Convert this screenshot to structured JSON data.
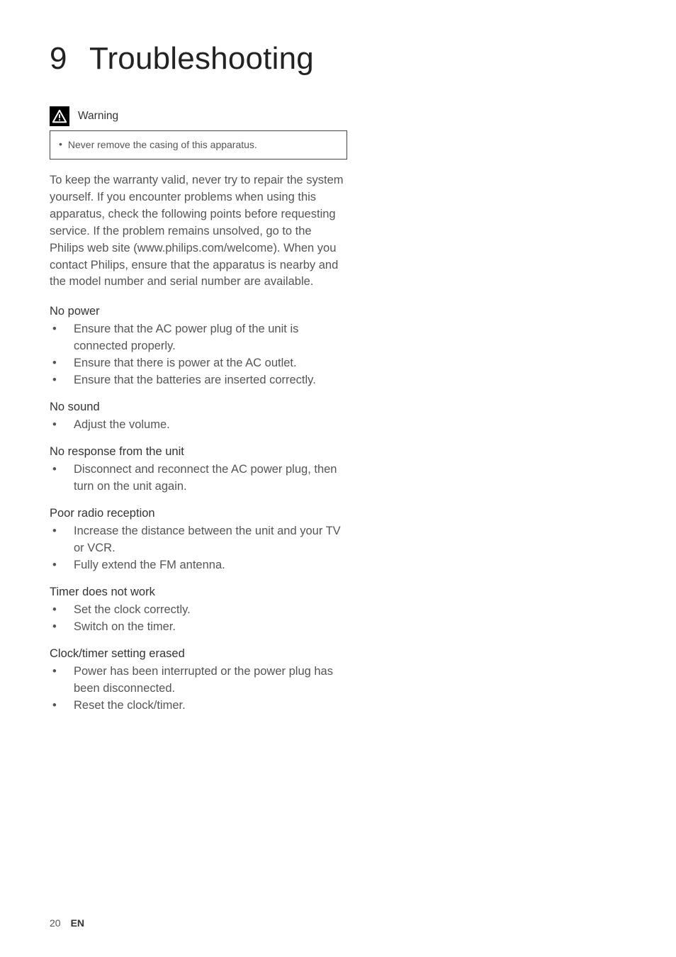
{
  "chapter": {
    "number": "9",
    "title": "Troubleshooting"
  },
  "warning": {
    "label": "Warning",
    "items": [
      "Never remove the casing of this apparatus."
    ]
  },
  "intro": "To keep the warranty valid, never try to repair the system yourself.\nIf you encounter problems when using this apparatus, check the following points before requesting service. If the problem remains unsolved, go to the Philips web site (www.philips.com/welcome). When you contact Philips, ensure that the apparatus is nearby and the model number and serial number are available.",
  "sections": [
    {
      "heading": "No power",
      "items": [
        "Ensure that the AC power plug of the unit is connected properly.",
        "Ensure that there is power at the AC outlet.",
        "Ensure that the batteries are inserted correctly."
      ]
    },
    {
      "heading": "No sound",
      "items": [
        "Adjust the volume."
      ]
    },
    {
      "heading": "No response from the unit",
      "items": [
        "Disconnect and reconnect the AC power plug, then turn on the unit again."
      ]
    },
    {
      "heading": "Poor radio reception",
      "items": [
        "Increase the distance between the unit and your TV or VCR.",
        "Fully extend the FM antenna."
      ]
    },
    {
      "heading": "Timer does not work",
      "items": [
        "Set the clock correctly.",
        "Switch on the timer."
      ]
    },
    {
      "heading": "Clock/timer setting erased",
      "items": [
        "Power has been interrupted or the power plug has been disconnected.",
        "Reset the clock/timer."
      ]
    }
  ],
  "footer": {
    "page": "20",
    "lang": "EN"
  }
}
